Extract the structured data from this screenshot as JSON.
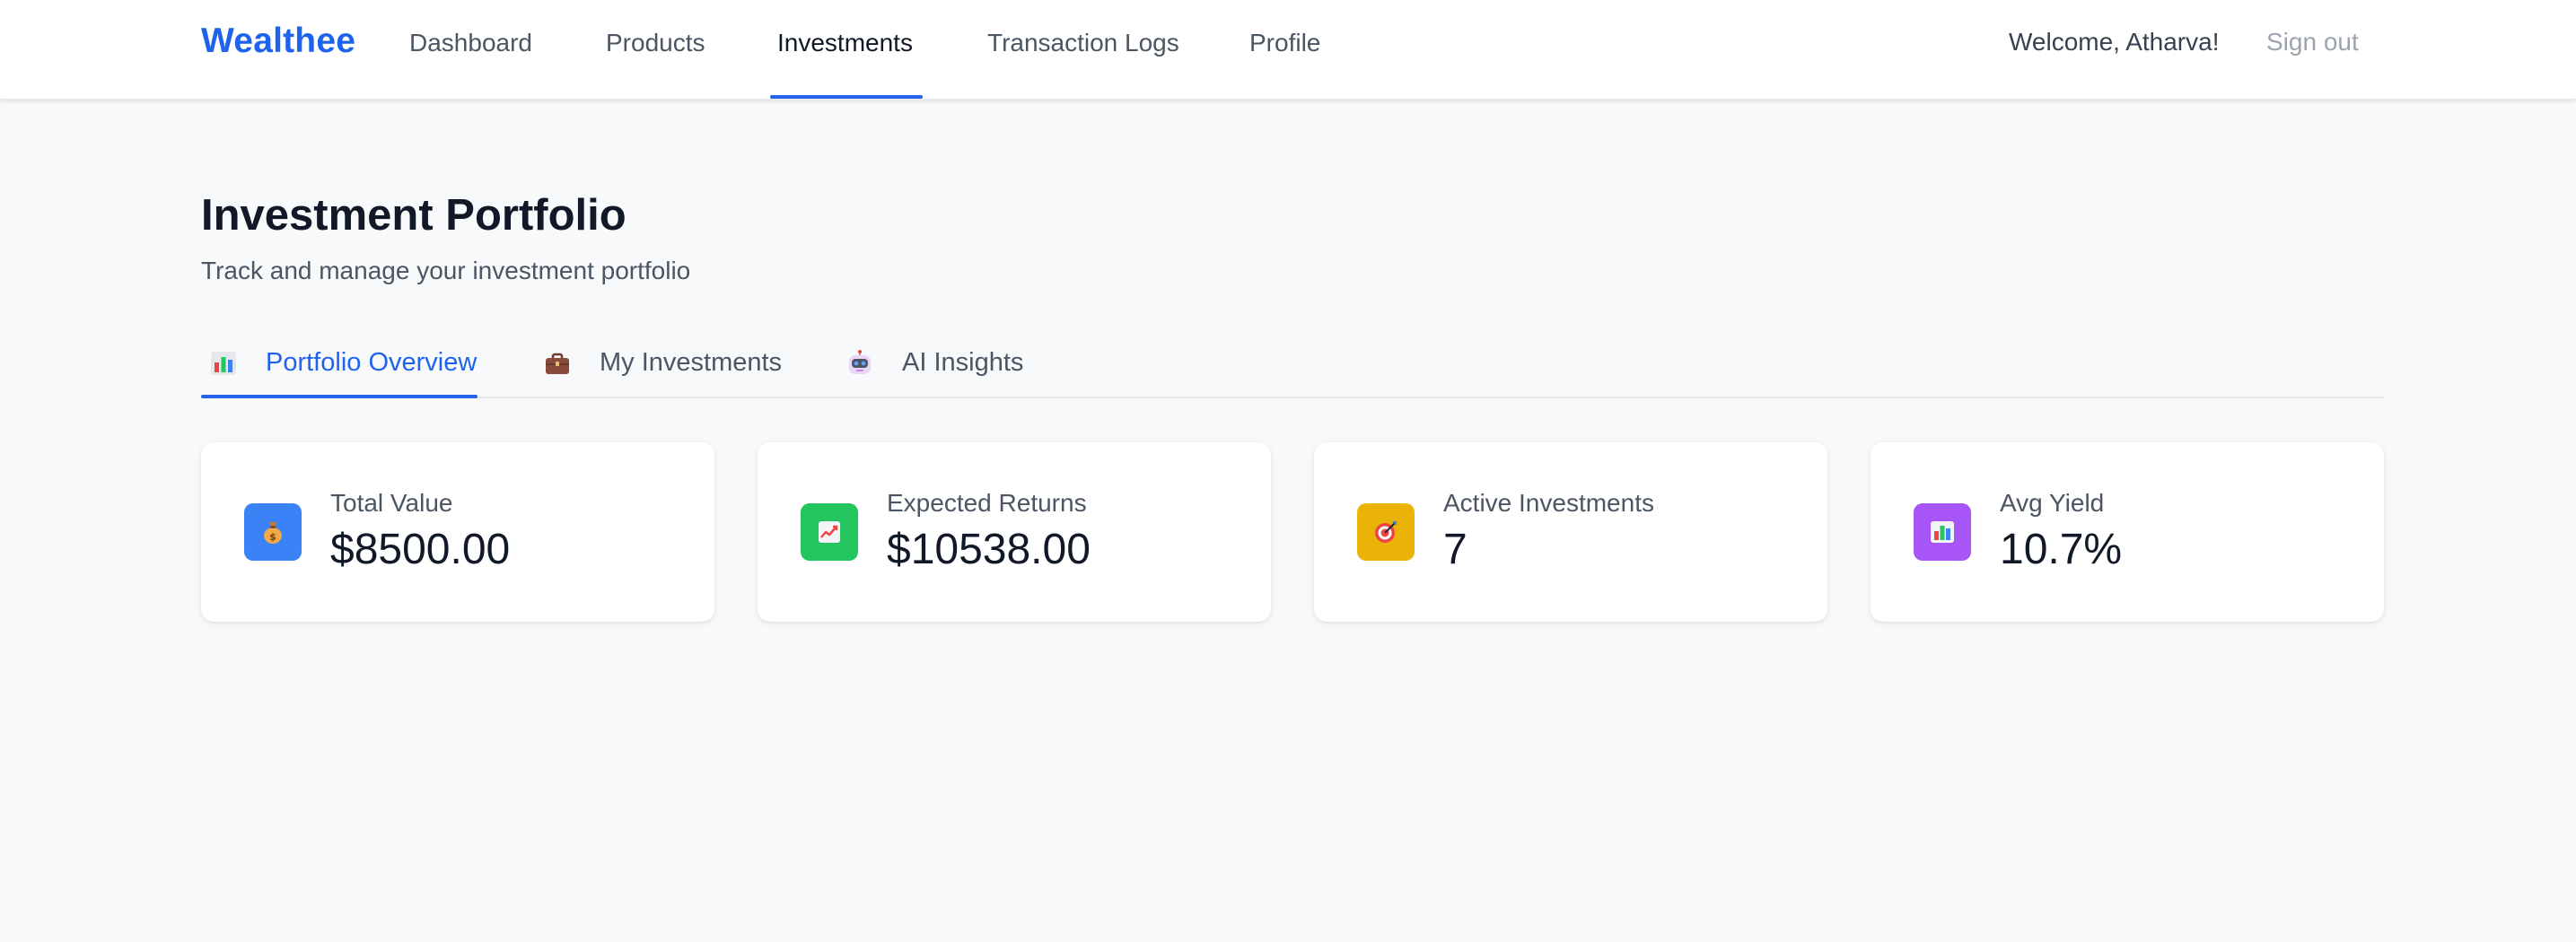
{
  "brand": "Wealthee",
  "nav": {
    "links": [
      "Dashboard",
      "Products",
      "Investments",
      "Transaction Logs",
      "Profile"
    ],
    "active": "Investments",
    "welcome": "Welcome, Atharva!",
    "signout": "Sign out"
  },
  "page": {
    "title": "Investment Portfolio",
    "subtitle": "Track and manage your investment portfolio"
  },
  "tabs": [
    {
      "label": "Portfolio Overview",
      "icon": "bar-chart-icon",
      "active": true
    },
    {
      "label": "My Investments",
      "icon": "briefcase-icon",
      "active": false
    },
    {
      "label": "AI Insights",
      "icon": "robot-icon",
      "active": false
    }
  ],
  "stats": [
    {
      "label": "Total Value",
      "value": "$8500.00",
      "icon": "money-bag-icon",
      "color": "#3b82f6"
    },
    {
      "label": "Expected Returns",
      "value": "$10538.00",
      "icon": "trend-up-chart-icon",
      "color": "#22c55e"
    },
    {
      "label": "Active Investments",
      "value": "7",
      "icon": "target-icon",
      "color": "#eab308"
    },
    {
      "label": "Avg Yield",
      "value": "10.7%",
      "icon": "bar-chart-icon",
      "color": "#a855f7"
    }
  ],
  "colors": {
    "brand": "#1d63ed",
    "accent": "#2563eb",
    "background": "#f8f9fb"
  }
}
